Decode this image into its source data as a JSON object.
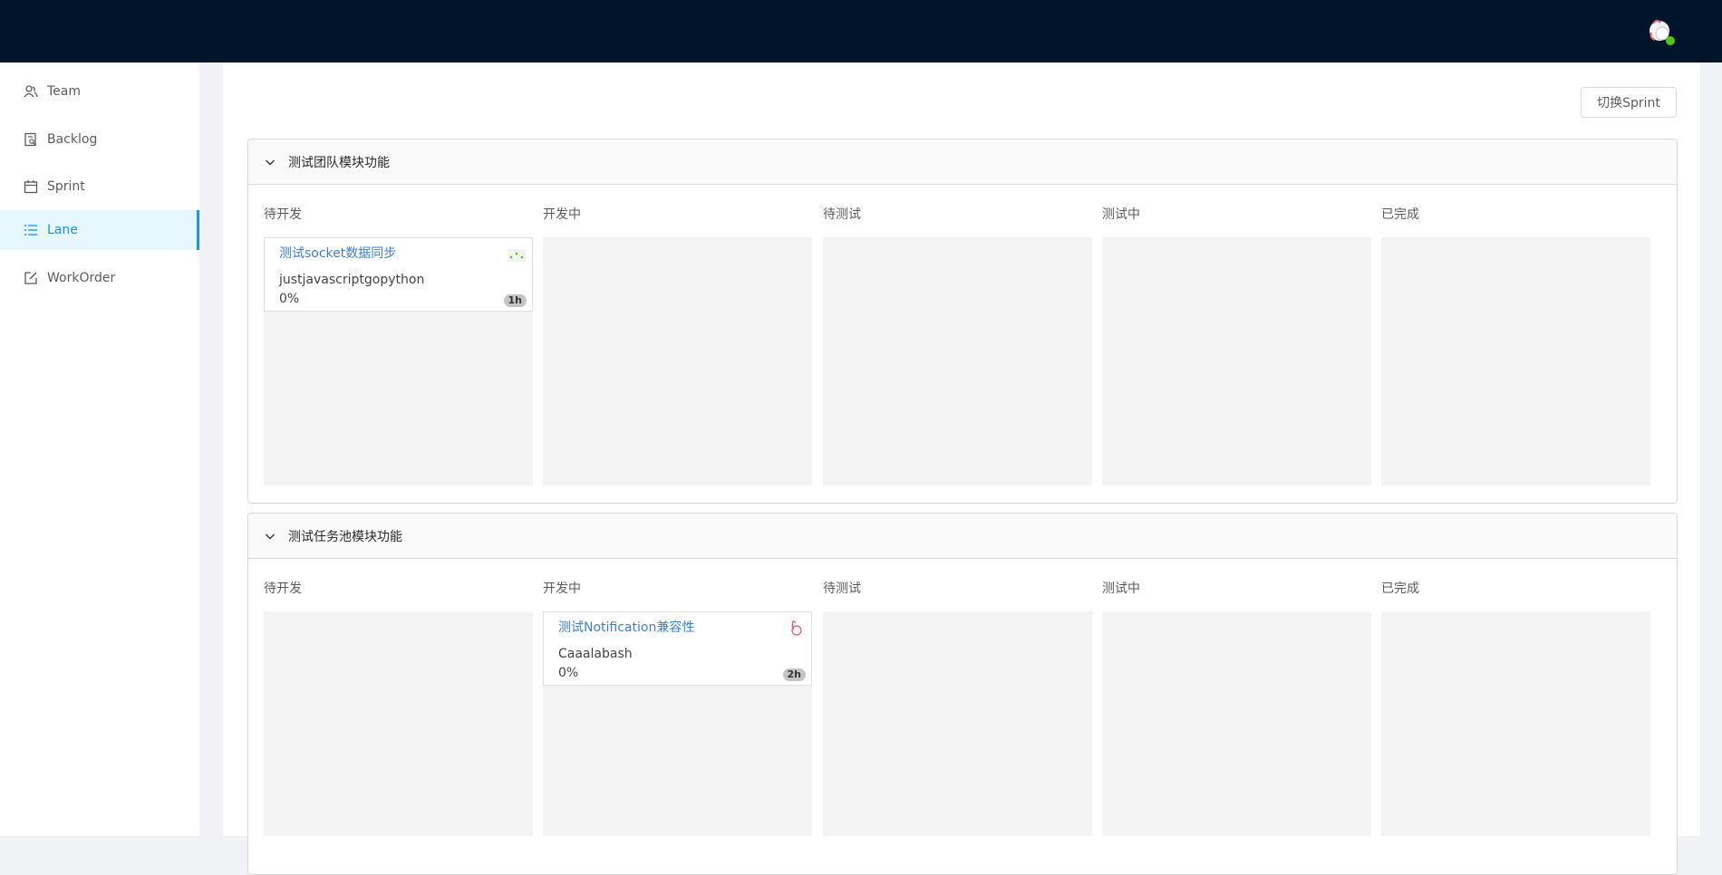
{
  "header": {
    "avatar_icon": "user-avatar-icon"
  },
  "sidebar": {
    "items": [
      {
        "label": "Team",
        "icon": "team-icon"
      },
      {
        "label": "Backlog",
        "icon": "backlog-icon"
      },
      {
        "label": "Sprint",
        "icon": "calendar-icon"
      },
      {
        "label": "Lane",
        "icon": "list-icon",
        "active": true
      },
      {
        "label": "WorkOrder",
        "icon": "edit-icon"
      }
    ]
  },
  "toolbar": {
    "switch_sprint_label": "切换Sprint"
  },
  "colors": {
    "accent": "#1890ff",
    "header_bg": "#001529",
    "card_title": "#3f7fc9"
  },
  "panels": [
    {
      "title": "测试团队模块功能",
      "columns": [
        "待开发",
        "开发中",
        "待测试",
        "测试中",
        "已完成"
      ],
      "cards": [
        {
          "column": 0,
          "title": "测试socket数据同步",
          "user": "justjavascriptgopython",
          "progress": "0%",
          "estimate": "1h"
        }
      ]
    },
    {
      "title": "测试任务池模块功能",
      "columns": [
        "待开发",
        "开发中",
        "待测试",
        "测试中",
        "已完成"
      ],
      "cards": [
        {
          "column": 1,
          "title": "测试Notification兼容性",
          "user": "Caaalabash",
          "progress": "0%",
          "estimate": "2h"
        }
      ]
    }
  ]
}
